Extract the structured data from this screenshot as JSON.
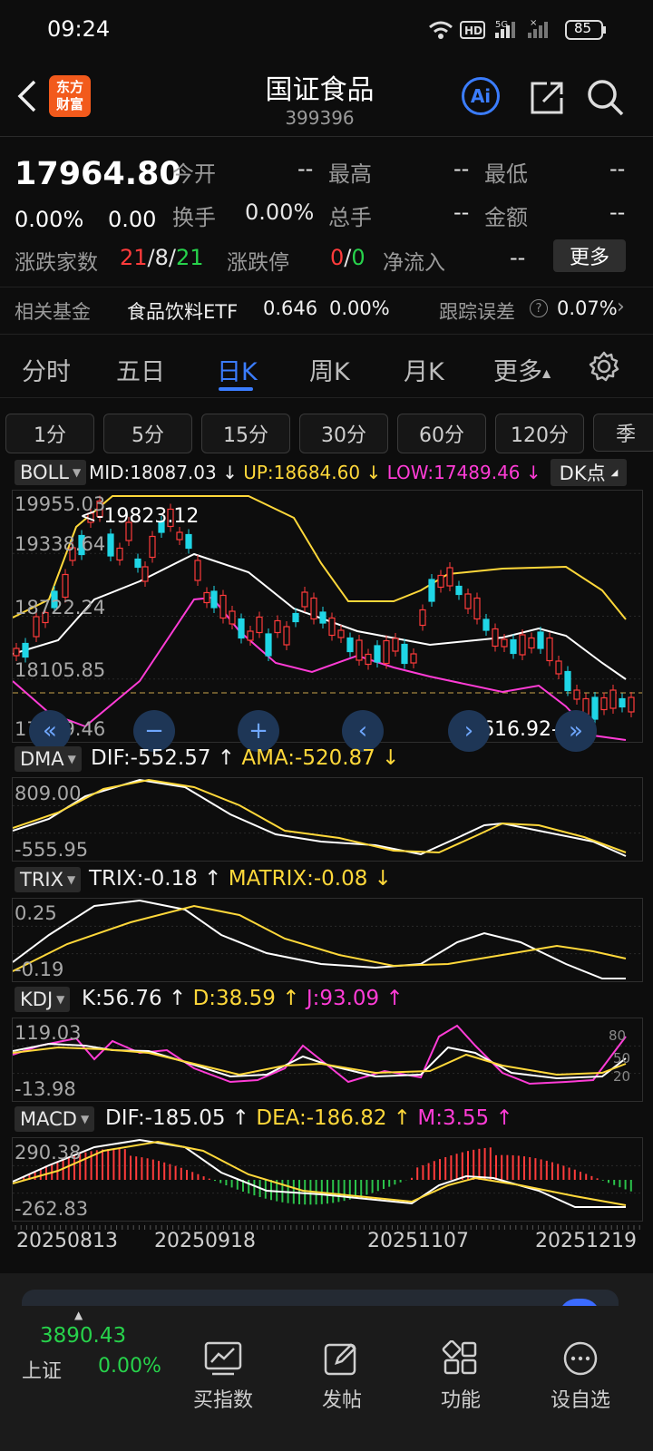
{
  "status_bar": {
    "time": "09:24",
    "network": "5G",
    "hd": "HD",
    "battery": "85"
  },
  "header": {
    "app_logo_line1": "东方",
    "app_logo_line2": "财富",
    "title": "国证食品",
    "code": "399396",
    "ai_label": "Ai"
  },
  "quote": {
    "price": "17964.80",
    "change_pct": "0.00%",
    "change": "0.00",
    "open_label": "今开",
    "open_value": "--",
    "high_label": "最高",
    "high_value": "--",
    "low_label": "最低",
    "low_value": "--",
    "turnover_label": "换手",
    "turnover_value": "0.00%",
    "volume_label": "总手",
    "volume_value": "--",
    "amount_label": "金额",
    "amount_value": "--",
    "updown_label": "涨跌家数",
    "up_count": "21",
    "flat_count": "8",
    "down_count": "21",
    "limit_label": "涨跌停",
    "limit_up": "0",
    "limit_down": "0",
    "netflow_label": "净流入",
    "netflow_value": "--",
    "more_button": "更多"
  },
  "fund_bar": {
    "label": "相关基金",
    "fund_name": "食品饮料ETF",
    "fund_price": "0.646",
    "fund_change": "0.00%",
    "tracking_label": "跟踪误差",
    "tracking_value": "0.07%"
  },
  "period_tabs": [
    {
      "label": "分时"
    },
    {
      "label": "五日"
    },
    {
      "label": "日K"
    },
    {
      "label": "周K"
    },
    {
      "label": "月K"
    },
    {
      "label": "更多"
    }
  ],
  "minute_tabs": [
    {
      "label": "1分"
    },
    {
      "label": "5分"
    },
    {
      "label": "15分"
    },
    {
      "label": "30分"
    },
    {
      "label": "60分"
    },
    {
      "label": "120分"
    },
    {
      "label": "季"
    }
  ],
  "boll": {
    "name": "BOLL",
    "mid": "MID:18087.03",
    "up": "UP:18684.60",
    "low": "LOW:17489.46",
    "dk_label": "DK点",
    "axis": [
      "19955.03",
      "19338.64",
      "18722.24",
      "18105.85",
      "17489.46"
    ],
    "max_marker": "<-19823.12",
    "min_marker": "17616.92->"
  },
  "dma": {
    "name": "DMA",
    "dif": "DIF:-552.57",
    "ama": "AMA:-520.87",
    "axis": [
      "809.00",
      "-555.95"
    ]
  },
  "trix": {
    "name": "TRIX",
    "trix": "TRIX:-0.18",
    "matrix": "MATRIX:-0.08",
    "axis": [
      "0.25",
      "-0.19"
    ]
  },
  "kdj": {
    "name": "KDJ",
    "k": "K:56.76",
    "d": "D:38.59",
    "j": "J:93.09",
    "axis": [
      "119.03",
      "-13.98"
    ],
    "right_axis": [
      "80",
      "50",
      "20"
    ]
  },
  "macd": {
    "name": "MACD",
    "dif": "DIF:-185.05",
    "dea": "DEA:-186.82",
    "m": "M:3.55",
    "axis": [
      "290.38",
      "-262.83"
    ]
  },
  "dates": [
    "20250813",
    "20250918",
    "20251107",
    "20251219"
  ],
  "bottom_nav": {
    "index_value": "3890.43",
    "index_name": "上证",
    "index_change": "0.00%",
    "items": [
      {
        "label": "买指数"
      },
      {
        "label": "发帖"
      },
      {
        "label": "功能"
      },
      {
        "label": "设自选"
      }
    ]
  },
  "colors": {
    "up": "#ff3b3b",
    "down": "#1fd6e6",
    "boll_mid": "#ffffff",
    "boll_up": "#ffd83a",
    "boll_low": "#ff3cd6",
    "accent": "#3b7dff"
  }
}
